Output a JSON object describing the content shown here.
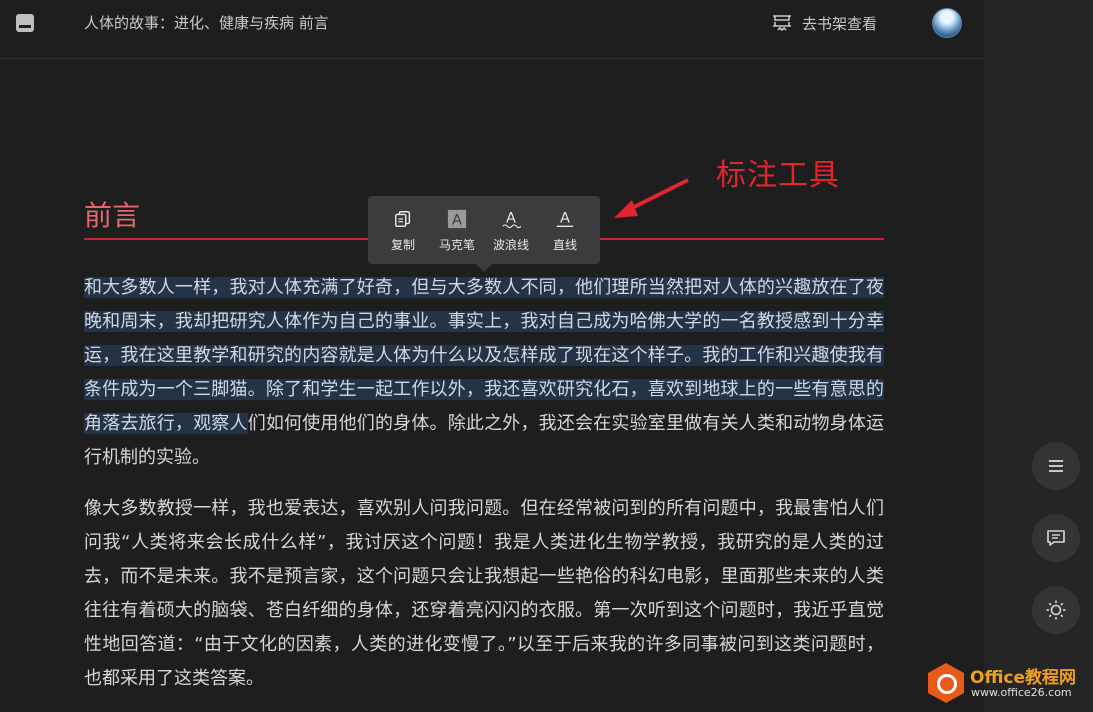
{
  "header": {
    "book_title": "人体的故事：进化、健康与疾病 前言",
    "goto_shelf_label": "去书架查看"
  },
  "chapter": {
    "title": "前言"
  },
  "annotation_tip": "标注工具",
  "toolbar": {
    "tools": [
      {
        "label": "复制",
        "icon": "copy-icon"
      },
      {
        "label": "马克笔",
        "icon": "marker-icon"
      },
      {
        "label": "波浪线",
        "icon": "wavy-underline-icon"
      },
      {
        "label": "直线",
        "icon": "straight-underline-icon"
      }
    ]
  },
  "content": {
    "p1_highlight": "和大多数人一样，我对人体充满了好奇，但与大多数人不同，他们理所当然把对人体的兴趣放在了夜晚和周末，我却把研究人体作为自己的事业。事实上，我对自己成为哈佛大学的一名教授感到十分幸运，我在这里教学和研究的内容就是人体为什么以及怎样成了现在这个样子。我的工作和兴趣使我有条件成为一个三脚猫。除了和学生一起工作以外，我还喜欢研究化石，喜欢到地球上的一些有意思的角落去旅行，观察人",
    "p1_rest": "们如何使用他们的身体。除此之外，我还会在实验室里做有关人类和动物身体运行机制的实验。",
    "p2": "像大多数教授一样，我也爱表达，喜欢别人问我问题。但在经常被问到的所有问题中，我最害怕人们问我“人类将来会长成什么样”，我讨厌这个问题！我是人类进化生物学教授，我研究的是人类的过去，而不是未来。我不是预言家，这个问题只会让我想起一些艳俗的科幻电影，里面那些未来的人类往往有着硕大的脑袋、苍白纤细的身体，还穿着亮闪闪的衣服。第一次听到这个问题时，我近乎直觉性地回答道：“由于文化的因素，人类的进化变慢了。”以至于后来我的许多同事被问到这类问题时，也都采用了这类答案。"
  },
  "sidebar": {
    "buttons": [
      "menu-icon",
      "comment-icon",
      "brightness-icon"
    ]
  },
  "watermark": {
    "title": "Office教程网",
    "url": "www.office26.com"
  },
  "colors": {
    "accent_red": "#c5252d",
    "highlight_bg": "#243446"
  }
}
